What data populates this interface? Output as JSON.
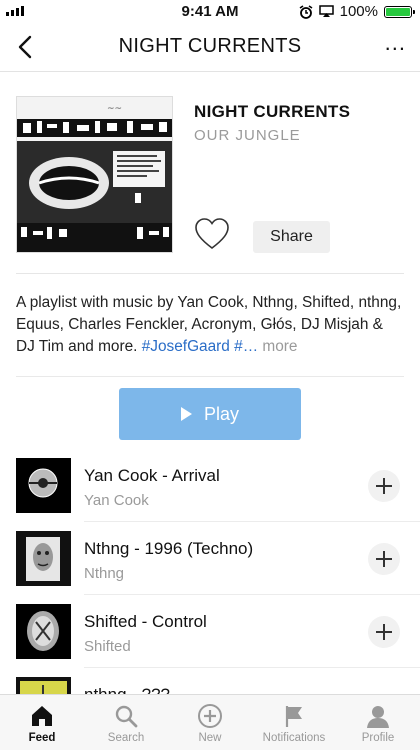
{
  "status": {
    "time": "9:41 AM",
    "battery": "100%",
    "battery_level": 1.0
  },
  "nav": {
    "title": "NIGHT CURRENTS",
    "more": "..."
  },
  "playlist": {
    "title": "NIGHT CURRENTS",
    "subtitle": "OUR JUNGLE",
    "share_label": "Share",
    "description": "A playlist with music by Yan Cook, Nthng, Shifted, nthng, Equus, Charles Fenckler, Acronym, Głós, DJ Misjah & DJ Tim and more. ",
    "hashtags": "#JosefGaard #…",
    "more_label": "more",
    "play_label": "Play"
  },
  "tracks": [
    {
      "title": "Yan Cook - Arrival",
      "artist": "Yan Cook"
    },
    {
      "title": "Nthng - 1996 (Techno)",
      "artist": "Nthng"
    },
    {
      "title": "Shifted - Control",
      "artist": "Shifted"
    },
    {
      "title": "nthng - ???",
      "artist": ""
    }
  ],
  "tabs": [
    {
      "label": "Feed",
      "icon": "home-icon",
      "active": true
    },
    {
      "label": "Search",
      "icon": "search-icon",
      "active": false
    },
    {
      "label": "New",
      "icon": "plus-circle-icon",
      "active": false
    },
    {
      "label": "Notifications",
      "icon": "flag-icon",
      "active": false
    },
    {
      "label": "Profile",
      "icon": "person-icon",
      "active": false
    }
  ],
  "colors": {
    "accent": "#7db7ea",
    "hashtag": "#2a6dc7",
    "battery": "#27c93f"
  }
}
